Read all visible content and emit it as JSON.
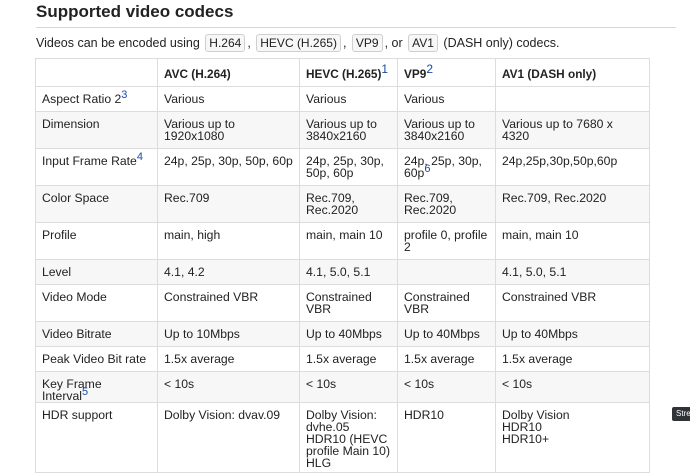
{
  "heading": "Supported video codecs",
  "intro": {
    "prefix": "Videos can be encoded using",
    "c1": "H.264",
    "c2": "HEVC (H.265)",
    "c3": "VP9",
    "or": ", or",
    "c4": "AV1",
    "suffix": "(DASH only) codecs."
  },
  "table": {
    "headers": {
      "h0": "",
      "h1": "AVC (H.264)",
      "h2": "HEVC (H.265)",
      "h2_fn": "1",
      "h3": "VP9",
      "h3_fn": "2",
      "h4": "AV1 (DASH only)"
    },
    "rows": [
      {
        "label": "Aspect Ratio 2",
        "fn": "3",
        "avc": "Various",
        "hevc": "Various",
        "vp9": "Various",
        "av1": ""
      },
      {
        "label": "Dimension",
        "avc": "Various up to 1920x1080",
        "hevc": "Various up to 3840x2160",
        "vp9": "Various up to 3840x2160",
        "av1": "Various up to 7680 x 4320"
      },
      {
        "label": "Input Frame Rate",
        "fn": "4",
        "avc": "24p, 25p, 30p, 50p, 60p",
        "hevc": "24p, 25p, 30p, 50p, 60p",
        "vp9": "24p, 25p, 30p, 60p",
        "vp9_fn": "6",
        "av1": "24p,25p,30p,50p,60p"
      },
      {
        "label": "Color Space",
        "avc": "Rec.709",
        "hevc": "Rec.709, Rec.2020",
        "vp9": "Rec.709, Rec.2020",
        "av1": "Rec.709, Rec.2020"
      },
      {
        "label": "Profile",
        "avc": "main, high",
        "hevc": "main, main 10",
        "vp9": "profile 0, profile 2",
        "av1": "main, main 10"
      },
      {
        "label": "Level",
        "avc": "4.1, 4.2",
        "hevc": "4.1, 5.0, 5.1",
        "vp9": "",
        "av1": "4.1, 5.0, 5.1"
      },
      {
        "label": "Video Mode",
        "avc": "Constrained VBR",
        "hevc": "Constrained VBR",
        "vp9": "Constrained VBR",
        "av1": "Constrained VBR"
      },
      {
        "label": "Video Bitrate",
        "avc": "Up to 10Mbps",
        "hevc": "Up to 40Mbps",
        "vp9": "Up to 40Mbps",
        "av1": "Up to 40Mbps"
      },
      {
        "label": "Peak Video Bit rate",
        "avc": "1.5x average",
        "hevc": "1.5x average",
        "vp9": "1.5x average",
        "av1": "1.5x average"
      },
      {
        "label": "Key Frame Interval",
        "fn": "5",
        "avc": "< 10s",
        "hevc": "< 10s",
        "vp9": "< 10s",
        "av1": "< 10s"
      },
      {
        "label": "HDR support",
        "avc": "Dolby Vision: dvav.09",
        "hevc": [
          "Dolby Vision:",
          "dvhe.05",
          "HDR10 (HEVC",
          "profile Main 10)",
          "HLG"
        ],
        "vp9": "HDR10",
        "av1": [
          "Dolby Vision",
          "HDR10",
          "HDR10+"
        ]
      }
    ]
  },
  "side_tab": "Stre"
}
